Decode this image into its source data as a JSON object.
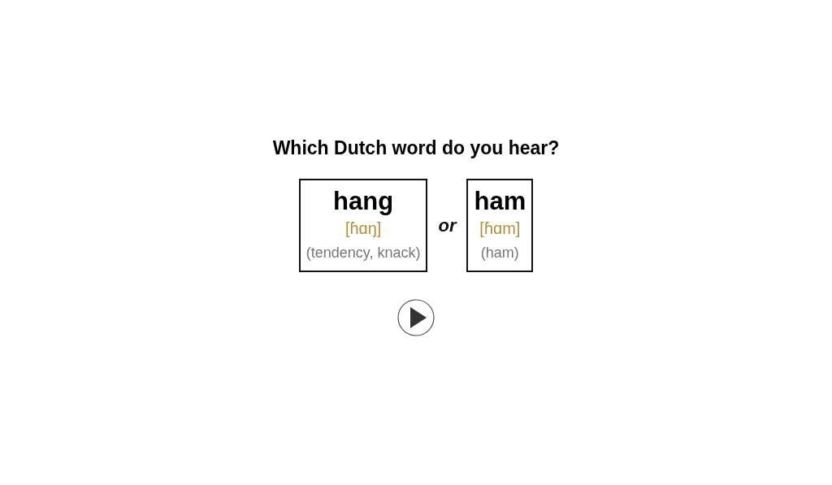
{
  "question": "Which Dutch word do you hear?",
  "options": [
    {
      "word": "hang",
      "ipa": "[ɦɑŋ]",
      "gloss": "(tendency, knack)"
    },
    {
      "word": "ham",
      "ipa": "[ɦɑm]",
      "gloss": "(ham)"
    }
  ],
  "separator": "or"
}
